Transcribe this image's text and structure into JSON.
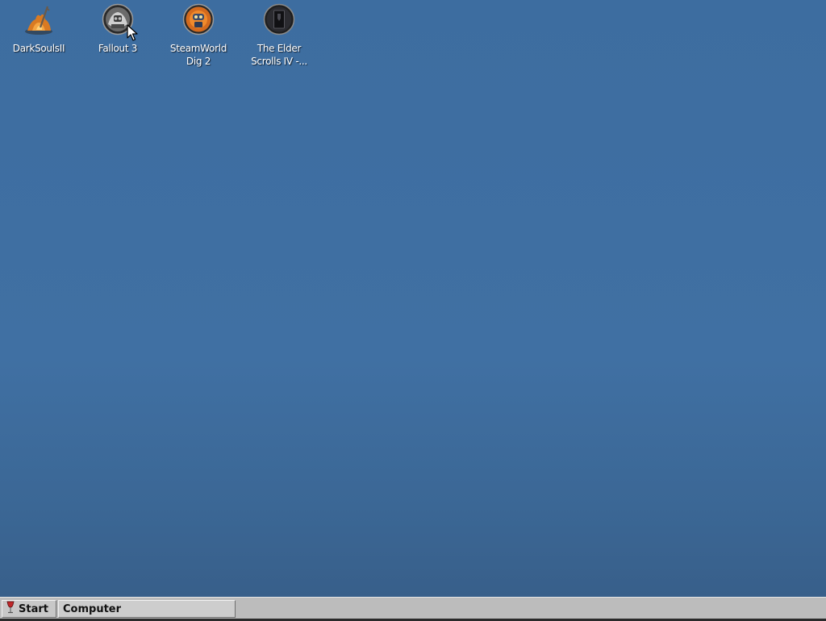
{
  "desktop": {
    "background_color": "#4070a3",
    "icons": [
      {
        "label": "DarkSoulsII",
        "icon": "bonfire-icon"
      },
      {
        "label": "Fallout 3",
        "icon": "fallout-icon"
      },
      {
        "label": "SteamWorld\nDig 2",
        "icon": "steamworld-icon"
      },
      {
        "label": "The Elder\nScrolls IV -...",
        "icon": "elder-scrolls-icon"
      }
    ]
  },
  "taskbar": {
    "start_label": "Start",
    "start_icon": "wine-glass-icon",
    "tasks": [
      {
        "label": "Computer"
      }
    ]
  }
}
